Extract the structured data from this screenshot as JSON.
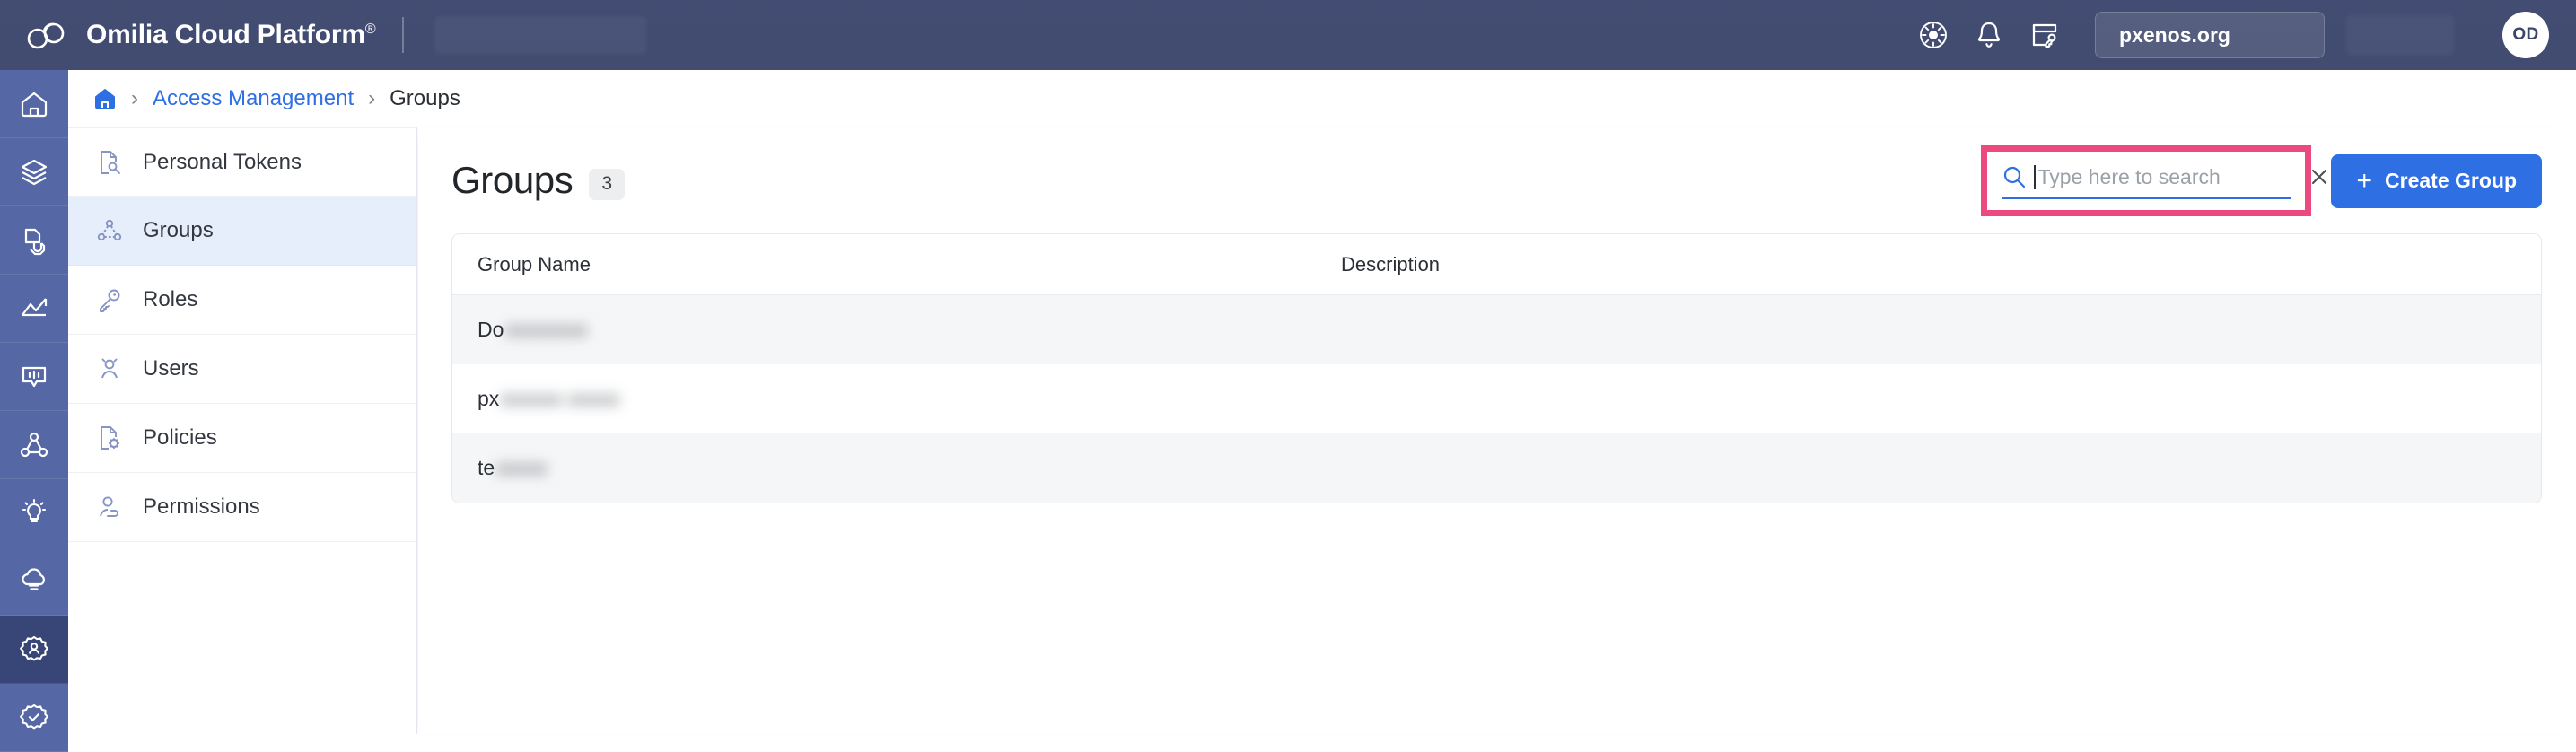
{
  "header": {
    "logo_icon": "omilia-cloud-logo",
    "brand": "Omilia Cloud Platform",
    "brand_mark": "®",
    "icons": [
      {
        "name": "brightness-icon",
        "label": "Brightness"
      },
      {
        "name": "notifications-bell-icon",
        "label": "Notifications"
      },
      {
        "name": "license-key-icon",
        "label": "License"
      }
    ],
    "env_badge": "pxenos.org",
    "avatar_initials": "OD"
  },
  "icon_rail": {
    "items": [
      {
        "name": "home-icon",
        "label": "Home",
        "active": false
      },
      {
        "name": "layers-icon",
        "label": "Layers",
        "active": false
      },
      {
        "name": "touch-icon",
        "label": "Interaction",
        "active": false
      },
      {
        "name": "analytics-icon",
        "label": "Analytics",
        "active": false
      },
      {
        "name": "dialog-icon",
        "label": "Dialog",
        "active": false
      },
      {
        "name": "network-icon",
        "label": "Flows",
        "active": false
      },
      {
        "name": "insights-icon",
        "label": "Insights",
        "active": false
      },
      {
        "name": "cloud-icon",
        "label": "Cloud",
        "active": false
      },
      {
        "name": "access-management-icon",
        "label": "Access Management",
        "active": true
      },
      {
        "name": "settings-check-icon",
        "label": "Settings",
        "active": false
      }
    ]
  },
  "breadcrumb": {
    "home_icon": "home-icon",
    "items": [
      {
        "label": "Access Management",
        "link": true
      },
      {
        "label": "Groups",
        "link": false
      }
    ],
    "separator": "›"
  },
  "submenu": {
    "items": [
      {
        "label": "Personal Tokens",
        "icon": "token-document-icon",
        "active": false
      },
      {
        "label": "Groups",
        "icon": "groups-icon",
        "active": true
      },
      {
        "label": "Roles",
        "icon": "key-icon",
        "active": false
      },
      {
        "label": "Users",
        "icon": "users-icon",
        "active": false
      },
      {
        "label": "Policies",
        "icon": "policy-document-icon",
        "active": false
      },
      {
        "label": "Permissions",
        "icon": "permissions-icon",
        "active": false
      }
    ]
  },
  "page": {
    "title": "Groups",
    "count": "3"
  },
  "search": {
    "icon": "search-icon",
    "placeholder": "Type here to search",
    "value": "",
    "clear_icon": "close-icon",
    "focused": true,
    "annotation_color": "#ec4a7f"
  },
  "create_button": {
    "plus": "+",
    "label": "Create Group"
  },
  "table": {
    "columns": [
      {
        "key": "group_name",
        "label": "Group Name"
      },
      {
        "key": "description",
        "label": "Description"
      }
    ],
    "rows": [
      {
        "name_visible": "Do",
        "name_redacted": "xxxxxxxx",
        "description": "",
        "striped": true
      },
      {
        "name_visible": "px",
        "name_redacted": "xxxxxx xxxxx",
        "description": "",
        "striped": false
      },
      {
        "name_visible": "te",
        "name_redacted": "xxxxx",
        "description": "",
        "striped": true
      }
    ]
  },
  "colors": {
    "header_bg": "#434d73",
    "rail_bg": "#5568a5",
    "rail_active": "#384677",
    "accent_blue": "#2f6fe4",
    "submenu_active": "#e5eefa",
    "annotation_pink": "#ec4a7f",
    "row_stripe": "#f5f6f7"
  }
}
